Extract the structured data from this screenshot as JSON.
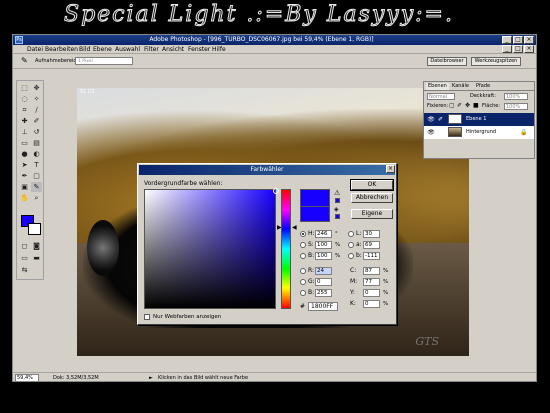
{
  "banner": {
    "text": "Special Light .:=By Lasyyy:=."
  },
  "window": {
    "title": "Adobe Photoshop - [996_TURBO_DSC06067.jpg bei 59,4% (Ebene 1, RGB)]",
    "app_icon": "photoshop-icon",
    "buttons": [
      "_",
      "□",
      "×"
    ]
  },
  "menu": [
    "Datei",
    "Bearbeiten",
    "Bild",
    "Ebene",
    "Auswahl",
    "Filter",
    "Ansicht",
    "Fenster",
    "Hilfe"
  ],
  "options": {
    "tool_icon": "eyedropper-icon",
    "label": "Aufnahmebereich:",
    "value": "1 Pixel",
    "tab_dateibrowser": "Dateibrowser",
    "tab_werkzeugspitzen": "Werkzeugspitzen"
  },
  "canvas": {
    "marker": "51 D1",
    "watermark": "GTS"
  },
  "layers": {
    "tabs": [
      "Ebenen",
      "Kanäle",
      "Pfade"
    ],
    "mode": "Normal",
    "opacity_label": "Deckkraft:",
    "opacity": "100%",
    "lock_label": "Fixieren:",
    "fill_label": "Fläche:",
    "fill": "100%",
    "items": [
      {
        "name": "Ebene 1",
        "selected": true
      },
      {
        "name": "Hintergrund",
        "selected": false
      }
    ]
  },
  "status": {
    "zoom": "59,4%",
    "doc": "Dok: 3,52M/3,52M",
    "hint": "Klicken in das Bild wählt neue Farbe"
  },
  "colorpicker": {
    "title": "Farbwähler",
    "close": "×",
    "prompt": "Vordergrundfarbe wählen:",
    "buttons": {
      "ok": "OK",
      "cancel": "Abbrechen",
      "custom": "Eigene"
    },
    "hsb": [
      {
        "label": "H:",
        "value": "246",
        "unit": "°",
        "checked": true
      },
      {
        "label": "S:",
        "value": "100",
        "unit": "%",
        "checked": false
      },
      {
        "label": "B:",
        "value": "100",
        "unit": "%",
        "checked": false
      }
    ],
    "rgb": [
      {
        "label": "R:",
        "value": "24",
        "checked": false
      },
      {
        "label": "G:",
        "value": "0",
        "checked": false
      },
      {
        "label": "B:",
        "value": "255",
        "checked": false
      }
    ],
    "lab": [
      {
        "label": "L:",
        "value": "30",
        "checked": false
      },
      {
        "label": "a:",
        "value": "69",
        "checked": false
      },
      {
        "label": "b:",
        "value": "-111",
        "checked": false
      }
    ],
    "cmyk": [
      {
        "label": "C:",
        "value": "87",
        "unit": "%"
      },
      {
        "label": "M:",
        "value": "77",
        "unit": "%"
      },
      {
        "label": "Y:",
        "value": "0",
        "unit": "%"
      },
      {
        "label": "K:",
        "value": "0",
        "unit": "%"
      }
    ],
    "hex_label": "#",
    "hex": "1800FF",
    "web_only_label": "Nur Webfarben anzeigen",
    "current_color": "#1800ff"
  }
}
